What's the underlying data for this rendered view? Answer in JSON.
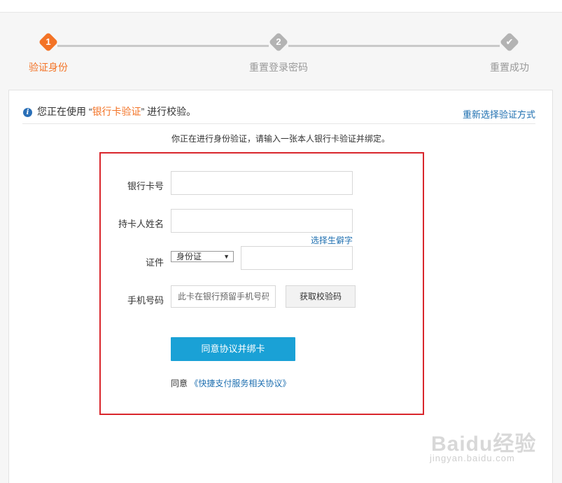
{
  "steps": [
    {
      "number": "1",
      "label": "验证身份",
      "state": "active"
    },
    {
      "number": "2",
      "label": "重置登录密码",
      "state": "pending"
    },
    {
      "number": "✔",
      "label": "重置成功",
      "state": "pending"
    }
  ],
  "colors": {
    "accent": "#f37326",
    "primary_button": "#1aa1d6",
    "link": "#1e6fb0",
    "highlight_border": "#d9262c"
  },
  "notice": {
    "prefix": "您正在使用 “",
    "method": "银行卡验证",
    "suffix": "” 进行校验。",
    "reselect_link": "重新选择验证方式"
  },
  "tip": "你正在进行身份验证，请输入一张本人银行卡验证并绑定。",
  "form": {
    "card_label": "银行卡号",
    "card_value": "",
    "name_label": "持卡人姓名",
    "name_value": "",
    "rare_char_link": "选择生僻字",
    "id_label": "证件",
    "id_type_selected": "身份证",
    "id_value": "",
    "phone_label": "手机号码",
    "phone_placeholder": "此卡在银行预留手机号码",
    "get_code_button": "获取校验码",
    "submit_button": "同意协议并绑卡",
    "agree_prefix": "同意",
    "agree_link": "《快捷支付服务相关协议》"
  },
  "watermark": {
    "brand": "Baidu经验",
    "url": "jingyan.baidu.com"
  }
}
